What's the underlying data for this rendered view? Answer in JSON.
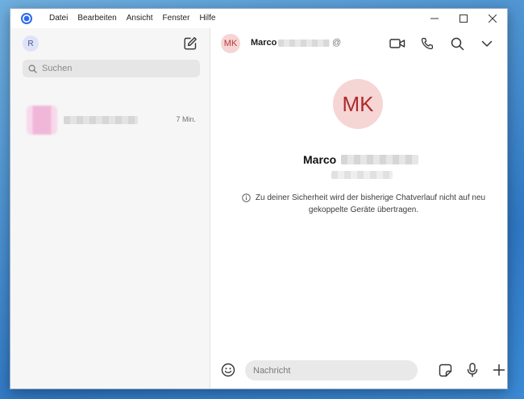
{
  "menu": [
    "Datei",
    "Bearbeiten",
    "Ansicht",
    "Fenster",
    "Hilfe"
  ],
  "profile": {
    "initial": "R"
  },
  "search": {
    "placeholder": "Suchen"
  },
  "conversation": {
    "time": "7 Min."
  },
  "contact": {
    "initials": "MK",
    "first_name": "Marco",
    "handle_suffix": "@"
  },
  "notice": {
    "text": "Zu deiner Sicherheit wird der bisherige Chatverlauf nicht auf neu gekoppelte Geräte übertragen."
  },
  "composer": {
    "placeholder": "Nachricht"
  },
  "colors": {
    "accent": "#2c6bed",
    "avatar_bg": "#f6d5d5",
    "avatar_text": "#b02a2a"
  },
  "icons": {
    "app": "signal-logo-icon",
    "compose": "compose-icon",
    "search": "search-icon",
    "video": "video-call-icon",
    "call": "phone-icon",
    "chat_search": "search-icon",
    "more": "chevron-down-icon",
    "info": "info-icon",
    "emoji": "emoji-icon",
    "sticker": "sticker-icon",
    "mic": "microphone-icon",
    "attach": "plus-icon"
  }
}
